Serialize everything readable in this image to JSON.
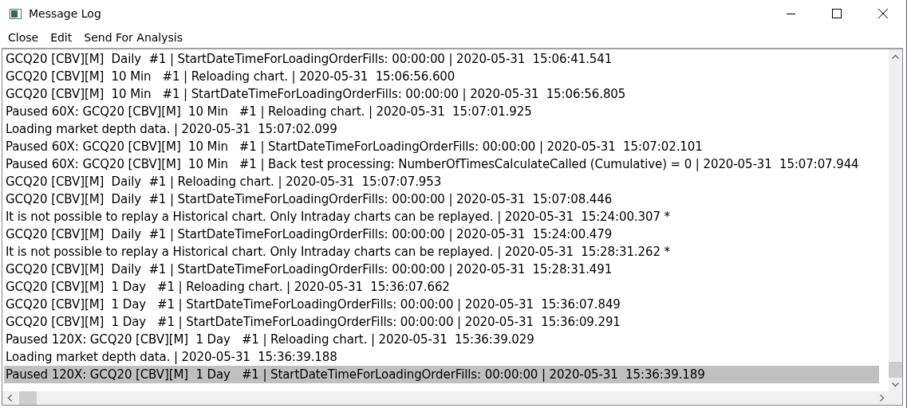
{
  "window": {
    "title": "Message Log"
  },
  "menu": [
    "Close",
    "Edit",
    "Send For Analysis"
  ],
  "rows": [
    {
      "text": "GCQ20 [CBV][M]  Daily  #1 | StartDateTimeForLoadingOrderFills: 00:00:00 | 2020-05-31  15:06:41.541",
      "selected": false
    },
    {
      "text": "GCQ20 [CBV][M]  10 Min   #1 | Reloading chart. | 2020-05-31  15:06:56.600",
      "selected": false
    },
    {
      "text": "GCQ20 [CBV][M]  10 Min   #1 | StartDateTimeForLoadingOrderFills: 00:00:00 | 2020-05-31  15:06:56.805",
      "selected": false
    },
    {
      "text": "Paused 60X: GCQ20 [CBV][M]  10 Min   #1 | Reloading chart. | 2020-05-31  15:07:01.925",
      "selected": false
    },
    {
      "text": "Loading market depth data. | 2020-05-31  15:07:02.099",
      "selected": false
    },
    {
      "text": "Paused 60X: GCQ20 [CBV][M]  10 Min   #1 | StartDateTimeForLoadingOrderFills: 00:00:00 | 2020-05-31  15:07:02.101",
      "selected": false
    },
    {
      "text": "Paused 60X: GCQ20 [CBV][M]  10 Min   #1 | Back test processing: NumberOfTimesCalculateCalled (Cumulative) = 0 | 2020-05-31  15:07:07.944",
      "selected": false
    },
    {
      "text": "GCQ20 [CBV][M]  Daily  #1 | Reloading chart. | 2020-05-31  15:07:07.953",
      "selected": false
    },
    {
      "text": "GCQ20 [CBV][M]  Daily  #1 | StartDateTimeForLoadingOrderFills: 00:00:00 | 2020-05-31  15:07:08.446",
      "selected": false
    },
    {
      "text": "It is not possible to replay a Historical chart. Only Intraday charts can be replayed. | 2020-05-31  15:24:00.307 *",
      "selected": false
    },
    {
      "text": "GCQ20 [CBV][M]  Daily  #1 | StartDateTimeForLoadingOrderFills: 00:00:00 | 2020-05-31  15:24:00.479",
      "selected": false
    },
    {
      "text": "It is not possible to replay a Historical chart. Only Intraday charts can be replayed. | 2020-05-31  15:28:31.262 *",
      "selected": false
    },
    {
      "text": "GCQ20 [CBV][M]  Daily  #1 | StartDateTimeForLoadingOrderFills: 00:00:00 | 2020-05-31  15:28:31.491",
      "selected": false
    },
    {
      "text": "GCQ20 [CBV][M]  1 Day   #1 | Reloading chart. | 2020-05-31  15:36:07.662",
      "selected": false
    },
    {
      "text": "GCQ20 [CBV][M]  1 Day   #1 | StartDateTimeForLoadingOrderFills: 00:00:00 | 2020-05-31  15:36:07.849",
      "selected": false
    },
    {
      "text": "GCQ20 [CBV][M]  1 Day   #1 | StartDateTimeForLoadingOrderFills: 00:00:00 | 2020-05-31  15:36:09.291",
      "selected": false
    },
    {
      "text": "Paused 120X: GCQ20 [CBV][M]  1 Day   #1 | Reloading chart. | 2020-05-31  15:36:39.029",
      "selected": false
    },
    {
      "text": "Loading market depth data. | 2020-05-31  15:36:39.188",
      "selected": false
    },
    {
      "text": "Paused 120X: GCQ20 [CBV][M]  1 Day   #1 | StartDateTimeForLoadingOrderFills: 00:00:00 | 2020-05-31  15:36:39.189",
      "selected": true
    }
  ]
}
